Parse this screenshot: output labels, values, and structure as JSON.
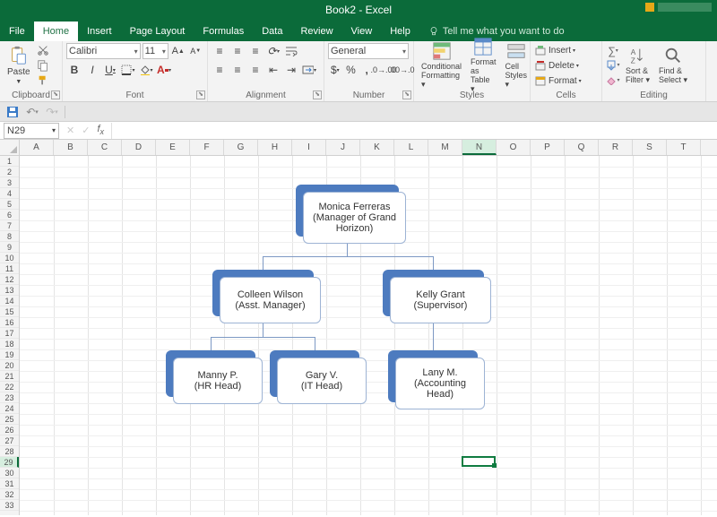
{
  "titlebar": {
    "title": "Book2 - Excel"
  },
  "menus": {
    "file": "File",
    "home": "Home",
    "insert": "Insert",
    "page_layout": "Page Layout",
    "formulas": "Formulas",
    "data": "Data",
    "review": "Review",
    "view": "View",
    "help": "Help",
    "tellme": "Tell me what you want to do"
  },
  "ribbon": {
    "clipboard": {
      "label": "Clipboard",
      "paste": "Paste"
    },
    "font": {
      "label": "Font",
      "name": "Calibri",
      "size": "11"
    },
    "alignment": {
      "label": "Alignment"
    },
    "number": {
      "label": "Number",
      "format": "General"
    },
    "styles": {
      "label": "Styles",
      "conditional": "Conditional Formatting",
      "conditional_sub": "",
      "formatas": "Format as Table",
      "formatas_sub": "",
      "cell": "Cell Styles",
      "cell_sub": ""
    },
    "cells": {
      "label": "Cells",
      "insert": "Insert",
      "delete": "Delete",
      "format": "Format"
    },
    "editing": {
      "label": "Editing",
      "sort": "Sort & Filter",
      "find": "Find & Select"
    }
  },
  "namebox": "N29",
  "columns": [
    "A",
    "B",
    "C",
    "D",
    "E",
    "F",
    "G",
    "H",
    "I",
    "J",
    "K",
    "L",
    "M",
    "N",
    "O",
    "P",
    "Q",
    "R",
    "S",
    "T"
  ],
  "rows": 33,
  "sel_col": "N",
  "sel_row": 29,
  "chart_data": {
    "type": "org",
    "nodes": [
      {
        "id": "monica",
        "name": "Monica Ferreras",
        "role": "(Manager of Grand Horizon)",
        "children": [
          "colleen",
          "kelly"
        ]
      },
      {
        "id": "colleen",
        "name": "Colleen Wilson",
        "role": "(Asst. Manager)",
        "children": [
          "manny",
          "gary"
        ]
      },
      {
        "id": "kelly",
        "name": "Kelly Grant",
        "role": "(Supervisor)",
        "children": [
          "lany"
        ]
      },
      {
        "id": "manny",
        "name": "Manny P.",
        "role": "(HR Head)",
        "children": []
      },
      {
        "id": "gary",
        "name": "Gary V.",
        "role": "(IT Head)",
        "children": []
      },
      {
        "id": "lany",
        "name": "Lany M.",
        "role": "(Accounting Head)",
        "children": []
      }
    ]
  }
}
